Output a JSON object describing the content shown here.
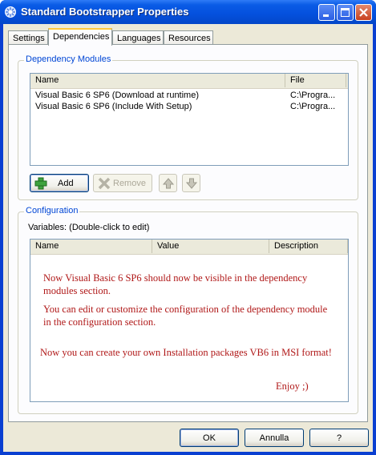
{
  "window": {
    "title": "Standard Bootstrapper Properties"
  },
  "tabs": [
    {
      "label": "Settings"
    },
    {
      "label": "Dependencies"
    },
    {
      "label": "Languages"
    },
    {
      "label": "Resources"
    }
  ],
  "dependency_modules": {
    "group_title": "Dependency Modules",
    "columns": [
      "Name",
      "File"
    ],
    "rows": [
      {
        "name": "Visual Basic 6 SP6 (Download at runtime)",
        "file": "C:\\Progra..."
      },
      {
        "name": "Visual Basic 6 SP6 (Include With Setup)",
        "file": "C:\\Progra..."
      }
    ],
    "add_label": "Add",
    "remove_label": "Remove"
  },
  "configuration": {
    "group_title": "Configuration",
    "variables_label": "Variables: (Double-click to edit)",
    "columns": [
      "Name",
      "Value",
      "Description"
    ],
    "notes": [
      "Now Visual Basic 6 SP6 should now be visible in the dependency modules section.",
      "You can edit or customize the configuration of the dependency module in the configuration section.",
      "Now you can create your own Installation packages VB6 in MSI format!",
      "Enjoy ;)"
    ]
  },
  "buttons": {
    "ok": "OK",
    "cancel": "Annulla",
    "help": "?"
  },
  "colors": {
    "title_bar": "#0450dd",
    "group_title": "#0046d5",
    "note_text": "#b01818"
  }
}
